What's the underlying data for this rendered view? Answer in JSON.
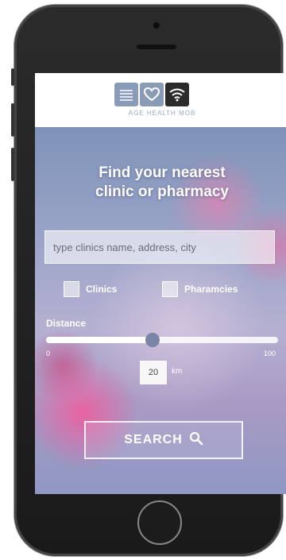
{
  "header": {
    "logo_icons": [
      "waves-icon",
      "heart-icon",
      "wifi-icon"
    ],
    "caption": "AGE HEALTH MOB"
  },
  "main": {
    "title_line1": "Find your nearest",
    "title_line2": "clinic or pharmacy",
    "search": {
      "placeholder": "type clinics name, address, city",
      "value": ""
    },
    "filters": [
      {
        "label": "Clinics",
        "checked": false
      },
      {
        "label": "Pharamcies",
        "checked": false
      }
    ],
    "distance": {
      "label": "Distance",
      "min": "0",
      "max": "100",
      "value": "20",
      "unit": "km",
      "fraction": 0.46
    },
    "search_button": "SEARCH"
  },
  "colors": {
    "accent_blue": "#7b86a6",
    "logo_dark": "#2b2b2b",
    "logo_light": "#8a9bb7"
  }
}
